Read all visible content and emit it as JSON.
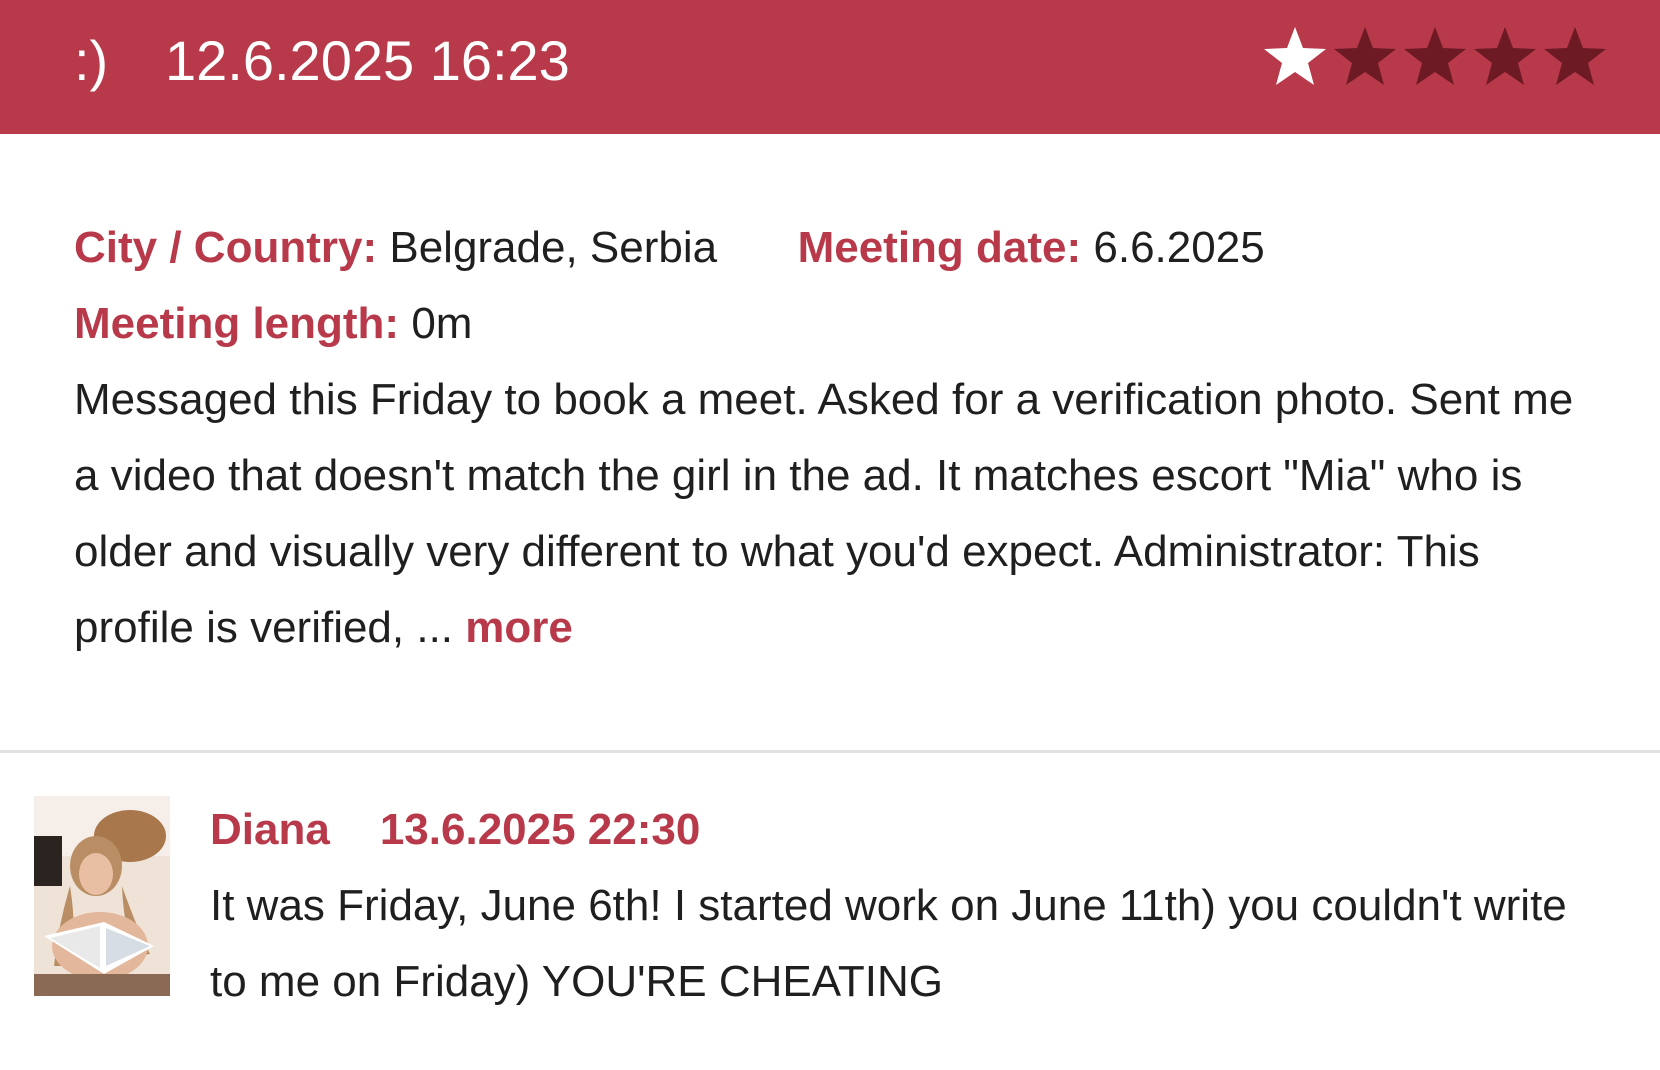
{
  "header": {
    "mood": ":)",
    "date": "12.6.2025 16:23",
    "rating": 1,
    "rating_max": 5,
    "colors": {
      "accent": "#b8394a",
      "star_filled": "#ffffff",
      "star_empty": "#6e1a25"
    }
  },
  "review": {
    "city_label": "City / Country:",
    "city_value": "Belgrade, Serbia",
    "date_label": "Meeting date:",
    "date_value": "6.6.2025",
    "length_label": "Meeting length:",
    "length_value": "0m",
    "text": "Messaged this Friday to book a meet. Asked for a verification photo. Sent me a video that doesn't match the girl in the ad. It matches escort \"Mia\" who is older and visually very different to what you'd expect. Administrator: This profile is verified, ...",
    "more_label": "more"
  },
  "comment": {
    "author": "Diana",
    "date": "13.6.2025 22:30",
    "text": "It was Friday, June 6th! I started work on June 11th) you couldn't write to me on Friday) YOU'RE CHEATING"
  }
}
